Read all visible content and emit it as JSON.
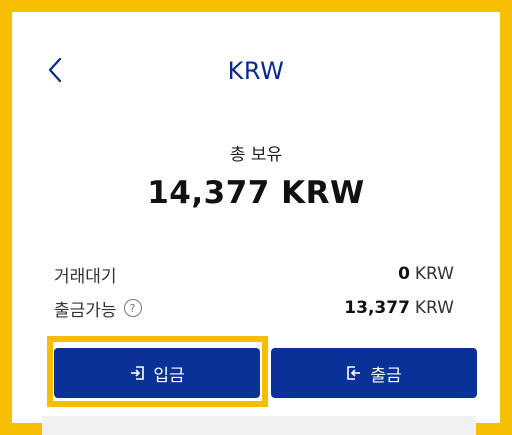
{
  "header": {
    "title": "KRW"
  },
  "summary": {
    "total_label": "총 보유",
    "total_amount": "14,377 KRW"
  },
  "rows": {
    "pending": {
      "label": "거래대기",
      "value": "0",
      "unit": "KRW"
    },
    "withdrawable": {
      "label": "출금가능",
      "help": "?",
      "value": "13,377",
      "unit": "KRW"
    }
  },
  "actions": {
    "deposit_label": "입금",
    "withdraw_label": "출금"
  },
  "colors": {
    "accent": "#0A3197",
    "highlight": "#F5BE00",
    "title": "#0A2A8F"
  },
  "icons": {
    "back": "chevron-left-icon",
    "deposit": "login-icon",
    "withdraw": "logout-icon",
    "help": "question-circle-icon"
  }
}
